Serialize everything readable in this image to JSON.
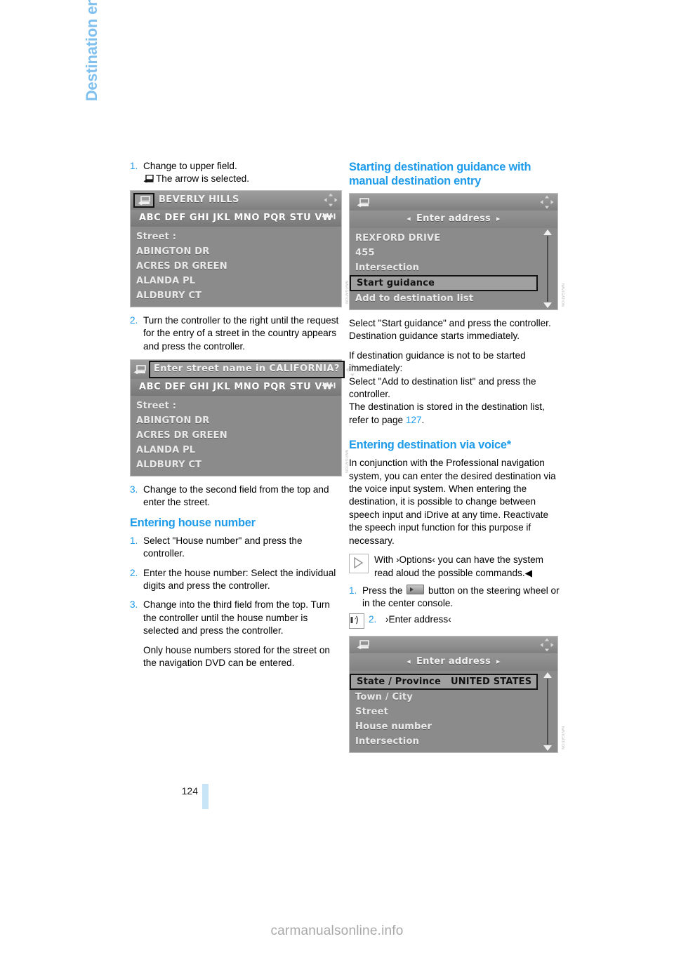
{
  "chapter_title": "Destination entry",
  "page_number": "124",
  "watermark": "carmanualsonline.info",
  "left_column": {
    "step1": {
      "num": "1.",
      "line1": "Change to upper field.",
      "line2": "The arrow is selected.",
      "icon": "back-arrow-icon"
    },
    "screenshot1": {
      "name": "street-entry-beverly-hills",
      "header_title": "BEVERLY HILLS",
      "header_back_icon": "back-arrow-icon",
      "header_cross_icon": "four-way-controller-icon",
      "letters": "ABC DEF GHI JKL MNO PQR STU VW",
      "delete_icon": "backspace-icon",
      "list": [
        "Street :",
        "ABINGTON DR",
        "ACRES DR GREEN",
        "ALANDA PL",
        "ALDBURY CT"
      ]
    },
    "step2": {
      "num": "2.",
      "text": "Turn the controller to the right until the request for the entry of a street in the country appears and press the controller."
    },
    "screenshot2": {
      "name": "street-entry-california-prompt",
      "header_title": "Enter street name in CALIFORNIA?",
      "header_back_icon": "back-arrow-icon",
      "header_cross_icon": "four-way-controller-icon",
      "letters": "ABC DEF GHI JKL MNO PQR STU VW",
      "delete_icon": "backspace-icon",
      "list": [
        "Street :",
        "ABINGTON DR",
        "ACRES DR GREEN",
        "ALANDA PL",
        "ALDBURY CT"
      ]
    },
    "step3": {
      "num": "3.",
      "text": "Change to the second field from the top and enter the street."
    },
    "house_number_heading": "Entering house number",
    "hn_step1": {
      "num": "1.",
      "text": "Select \"House number\" and press the controller."
    },
    "hn_step2": {
      "num": "2.",
      "text": "Enter the house number: Select the individual digits and press the controller."
    },
    "hn_step3": {
      "num": "3.",
      "text": "Change into the third field from the top. Turn the controller until the house number is selected and press the controller."
    },
    "hn_note": "Only house numbers stored for the street on the navigation DVD can be entered."
  },
  "right_column": {
    "heading1": "Starting destination guidance with manual destination entry",
    "screenshot3": {
      "name": "enter-address-start-guidance",
      "header_back_icon": "back-arrow-icon",
      "header_cross_icon": "four-way-controller-icon",
      "subbar": "Enter address",
      "list": [
        "REXFORD DRIVE",
        "455",
        "Intersection"
      ],
      "highlight_row": "Start guidance",
      "last_row": "Add to destination list",
      "scroll_up_icon": "scroll-up-arrow-icon",
      "scroll_down_icon": "scroll-down-arrow-icon"
    },
    "para1": "Select \"Start guidance\" and press the controller.",
    "para2": "Destination guidance starts immediately.",
    "para3": "If destination guidance is not to be started immediately:",
    "para4": "Select \"Add to destination list\" and press the controller.",
    "para5_pre": "The destination is stored in the destination list, refer to page ",
    "para5_link": "127",
    "para5_post": ".",
    "heading2": "Entering destination via voice*",
    "para6": "In conjunction with the Professional navigation system, you can enter the desired destination via the voice input system. When entering the destination, it is possible to change between speech input and iDrive at any time. Reactivate the speech input function for this purpose if necessary.",
    "note": {
      "icon": "play-triangle-icon",
      "text": "With ›Options‹ you can have the system read aloud the possible commands.◀"
    },
    "voice_step1": {
      "num": "1.",
      "text_pre": "Press the ",
      "button_icon": "voice-button-icon",
      "text_post": " button on the steering wheel or in the center console."
    },
    "voice_step2": {
      "num": "2.",
      "icon": "speech-input-icon",
      "text": "›Enter address‹"
    },
    "screenshot4": {
      "name": "enter-address-fields",
      "header_back_icon": "back-arrow-icon",
      "header_cross_icon": "four-way-controller-icon",
      "subbar": "Enter address",
      "highlight_label": "State / Province",
      "highlight_value": "UNITED STATES",
      "list": [
        "Town / City",
        "Street",
        "House number",
        "Intersection"
      ],
      "scroll_up_icon": "scroll-up-arrow-icon",
      "scroll_down_icon": "scroll-down-arrow-icon"
    }
  },
  "colors": {
    "accent_blue": "#1E9BE9",
    "tab_blue": "#7FC0EE",
    "page_bar_blue": "#C8E4F7"
  }
}
